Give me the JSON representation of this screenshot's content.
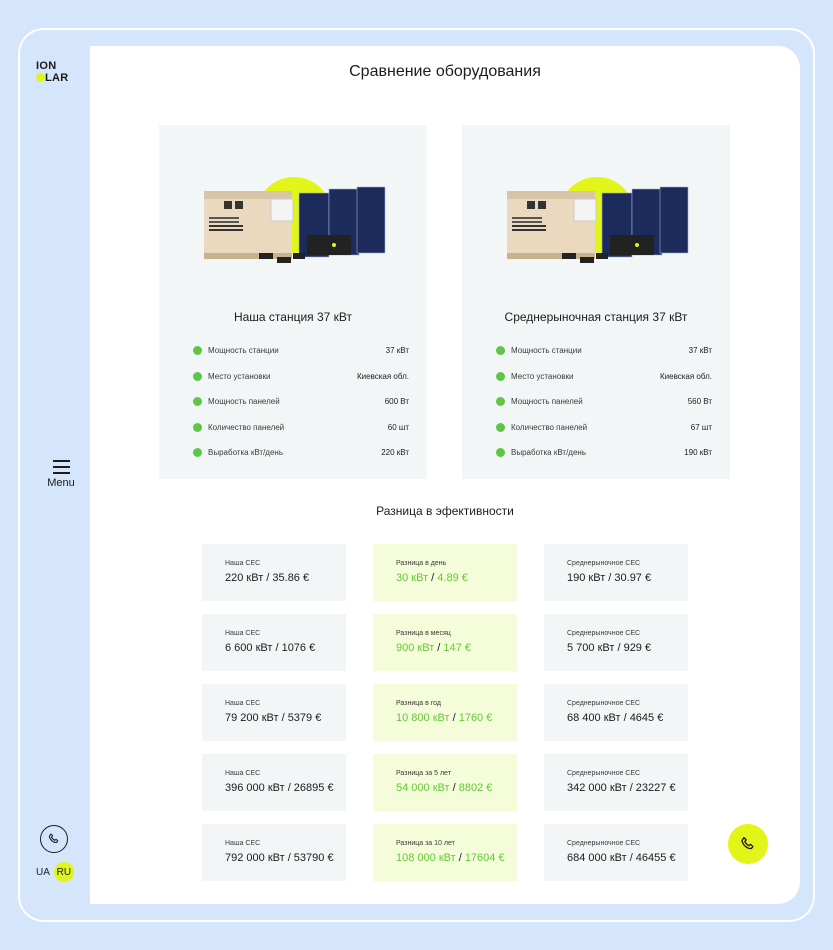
{
  "brand": {
    "line1": "ION",
    "line2_pre": "S",
    "line2_post": "LAR"
  },
  "nav": {
    "menu_label": "Menu"
  },
  "languages": [
    {
      "code": "UA",
      "active": false
    },
    {
      "code": "RU",
      "active": true
    }
  ],
  "colors": {
    "accent": "#e2f519",
    "green": "#5ec546",
    "page_bg": "#d5e5fb"
  },
  "page_title": "Сравнение оборудования",
  "cards": [
    {
      "name": "Наша станция 37 кВт",
      "image_icon": "solar-kit-image",
      "specs": [
        {
          "label": "Мощность станции",
          "value": "37 кВт"
        },
        {
          "label": "Место установки",
          "value": "Киевская обл."
        },
        {
          "label": "Мощность панелей",
          "value": "600 Вт"
        },
        {
          "label": "Количество панелей",
          "value": "60 шт"
        },
        {
          "label": "Выработка кВт/день",
          "value": "220 кВт"
        }
      ]
    },
    {
      "name": "Среднерыночная станция 37 кВт",
      "image_icon": "solar-kit-image",
      "specs": [
        {
          "label": "Мощность станции",
          "value": "37 кВт"
        },
        {
          "label": "Место установки",
          "value": "Киевская обл."
        },
        {
          "label": "Мощность панелей",
          "value": "560 Вт"
        },
        {
          "label": "Количество панелей",
          "value": "67 шт"
        },
        {
          "label": "Выработка кВт/день",
          "value": "190 кВт"
        }
      ]
    }
  ],
  "difference_title": "Разница в эфективности",
  "rows": [
    {
      "ours": {
        "label": "Наша СЕС",
        "value": "220 кВт / 35.86 €"
      },
      "diff": {
        "label": "Разница в день",
        "kwt": "30 кВт",
        "sep": " / ",
        "eur": "4.89 €"
      },
      "market": {
        "label": "Среднерыночное СЕС",
        "value": "190 кВт / 30.97 €"
      }
    },
    {
      "ours": {
        "label": "Наша СЕС",
        "value": "6 600 кВт / 1076 €"
      },
      "diff": {
        "label": "Разница в месяц",
        "kwt": "900 кВт",
        "sep": " / ",
        "eur": "147 €"
      },
      "market": {
        "label": "Среднерыночное СЕС",
        "value": "5 700 кВт / 929 €"
      }
    },
    {
      "ours": {
        "label": "Наша СЕС",
        "value": "79 200 кВт / 5379 €"
      },
      "diff": {
        "label": "Разница в год",
        "kwt": "10 800 кВт",
        "sep": " / ",
        "eur": "1760 €"
      },
      "market": {
        "label": "Среднерыночное СЕС",
        "value": "68 400 кВт / 4645 €"
      }
    },
    {
      "ours": {
        "label": "Наша СЕС",
        "value": "396 000 кВт / 26895 €"
      },
      "diff": {
        "label": "Разница за 5 лет",
        "kwt": "54 000 кВт",
        "sep": " / ",
        "eur": "8802 €"
      },
      "market": {
        "label": "Среднерыночное СЕС",
        "value": "342 000 кВт / 23227 €"
      }
    },
    {
      "ours": {
        "label": "Наша СЕС",
        "value": "792 000 кВт / 53790 €"
      },
      "diff": {
        "label": "Разница за 10 лет",
        "kwt": "108 000 кВт",
        "sep": " / ",
        "eur": "17604 €"
      },
      "market": {
        "label": "Среднерыночное СЕС",
        "value": "684 000 кВт / 46455 €"
      }
    }
  ],
  "icons": {
    "sidebar_phone": "phone-icon",
    "floating_phone": "phone-icon"
  }
}
